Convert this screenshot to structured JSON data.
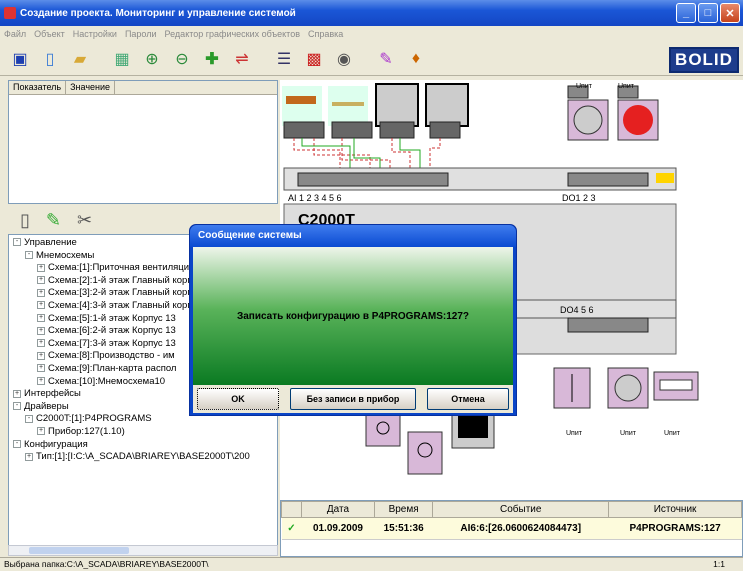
{
  "window": {
    "title": "Создание проекта. Мониторинг и управление системой"
  },
  "menu": [
    "Файл",
    "Объект",
    "Настройки",
    "Пароли",
    "Редактор графических объектов",
    "Справка"
  ],
  "logo": "BOLID",
  "properties": {
    "col_indicator": "Показатель",
    "col_value": "Значение"
  },
  "tree": [
    {
      "text": "Управление",
      "indent": 0,
      "exp": "-"
    },
    {
      "text": "Мнемосхемы",
      "indent": 1,
      "exp": "-"
    },
    {
      "text": "Схема:[1]:Приточная вентиляция",
      "indent": 2,
      "exp": "+"
    },
    {
      "text": "Схема:[2]:1-й этаж Главный корпус",
      "indent": 2,
      "exp": "+"
    },
    {
      "text": "Схема:[3]:2-й этаж Главный корпус",
      "indent": 2,
      "exp": "+"
    },
    {
      "text": "Схема:[4]:3-й этаж Главный корпус",
      "indent": 2,
      "exp": "+"
    },
    {
      "text": "Схема:[5]:1-й этаж Корпус 13",
      "indent": 2,
      "exp": "+"
    },
    {
      "text": "Схема:[6]:2-й этаж Корпус 13",
      "indent": 2,
      "exp": "+"
    },
    {
      "text": "Схема:[7]:3-й этаж Корпус 13",
      "indent": 2,
      "exp": "+"
    },
    {
      "text": "Схема:[8]:Производство - им",
      "indent": 2,
      "exp": "+"
    },
    {
      "text": "Схема:[9]:План-карта распол",
      "indent": 2,
      "exp": "+"
    },
    {
      "text": "Схема:[10]:Мнемосхема10",
      "indent": 2,
      "exp": "+"
    },
    {
      "text": "Интерфейсы",
      "indent": 0,
      "exp": "+"
    },
    {
      "text": "Драйверы",
      "indent": 0,
      "exp": "-"
    },
    {
      "text": "C2000T:[1]:P4PROGRAMS",
      "indent": 1,
      "exp": "-"
    },
    {
      "text": "Прибор:127(1.10)",
      "indent": 2,
      "exp": "+"
    },
    {
      "text": "Конфигурация",
      "indent": 0,
      "exp": "-"
    },
    {
      "text": "Тип:[1]:[I:C:\\A_SCADA\\BRIAREY\\BASE2000T\\200",
      "indent": 1,
      "exp": "+"
    }
  ],
  "canvas": {
    "device_name": "C2000T",
    "ai_labels": [
      "AI",
      "1",
      "2",
      "3",
      "4",
      "5",
      "6"
    ],
    "do1_labels": [
      "DO1",
      "2",
      "3"
    ],
    "do4_labels": [
      "DO4",
      "5",
      "6"
    ],
    "upit_label": "Uпит"
  },
  "dialog": {
    "title": "Сообщение системы",
    "message": "Записать конфигурацию в P4PROGRAMS:127?",
    "ok": "OK",
    "no_write": "Без записи в прибор",
    "cancel": "Отмена"
  },
  "events": {
    "headers": [
      "Дата",
      "Время",
      "Событие",
      "Источник"
    ],
    "rows": [
      {
        "date": "01.09.2009",
        "time": "15:51:36",
        "event": "AI6:6:[26.0600624084473]",
        "source": "P4PROGRAMS:127"
      }
    ]
  },
  "status": {
    "text": "Выбрана папка:C:\\A_SCADA\\BRIAREY\\BASE2000T\\",
    "page": "1:1"
  }
}
